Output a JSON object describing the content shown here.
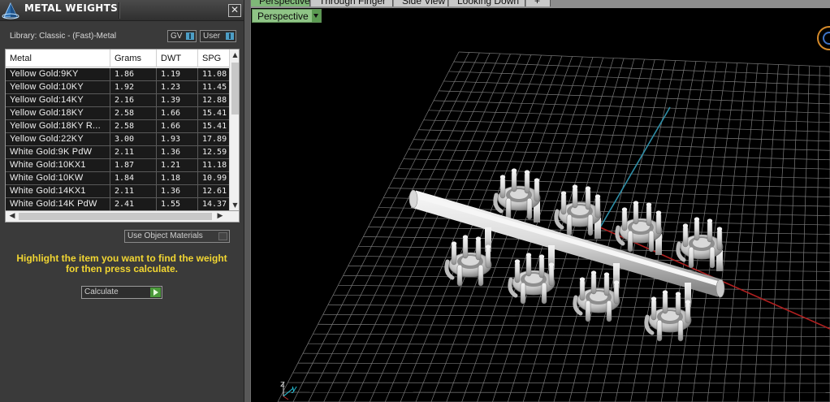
{
  "panel": {
    "title": "METAL WEIGHTS",
    "close_glyph": "✕",
    "library_label": "Library: Classic - (Fast)-Metal",
    "gv_label": "GV",
    "user_label": "User",
    "use_object_materials_label": "Use Object Materials",
    "instructions_line1": "Highlight the item you want to find the weight",
    "instructions_line2": "for then press calculate.",
    "calculate_label": "Calculate"
  },
  "table": {
    "columns": [
      "Metal",
      "Grams",
      "DWT",
      "SPG"
    ],
    "rows": [
      [
        "Yellow Gold:9KY",
        "1.86",
        "1.19",
        "11.08"
      ],
      [
        "Yellow Gold:10KY",
        "1.92",
        "1.23",
        "11.45"
      ],
      [
        "Yellow Gold:14KY",
        "2.16",
        "1.39",
        "12.88"
      ],
      [
        "Yellow Gold:18KY",
        "2.58",
        "1.66",
        "15.41"
      ],
      [
        "Yellow Gold:18KY R...",
        "2.58",
        "1.66",
        "15.41"
      ],
      [
        "Yellow Gold:22KY",
        "3.00",
        "1.93",
        "17.89"
      ],
      [
        "White Gold:9K PdW",
        "2.11",
        "1.36",
        "12.59"
      ],
      [
        "White Gold:10KX1",
        "1.87",
        "1.21",
        "11.18"
      ],
      [
        "White Gold:10KW",
        "1.84",
        "1.18",
        "10.99"
      ],
      [
        "White Gold:14KX1",
        "2.11",
        "1.36",
        "12.61"
      ],
      [
        "White Gold:14K PdW",
        "2.41",
        "1.55",
        "14.37"
      ]
    ]
  },
  "viewport": {
    "tabs": [
      "Perspective",
      "Through Finger",
      "Side View",
      "Looking Down",
      "+"
    ],
    "active_tab": "Perspective",
    "view_selector": "Perspective",
    "axis_z": "z",
    "axis_y": "y"
  },
  "colors": {
    "panel_bg": "#3a3a3a",
    "instructions": "#f2d632",
    "tab_active": "#7fb878",
    "grid_line": "#7a7a7a",
    "axis_red": "#b02020",
    "axis_teal": "#2f8fa8"
  },
  "icons": {
    "logo": "pyramid-logo-icon",
    "close": "close-icon",
    "calculate": "play-icon",
    "view_dropdown": "chevron-down-icon"
  }
}
